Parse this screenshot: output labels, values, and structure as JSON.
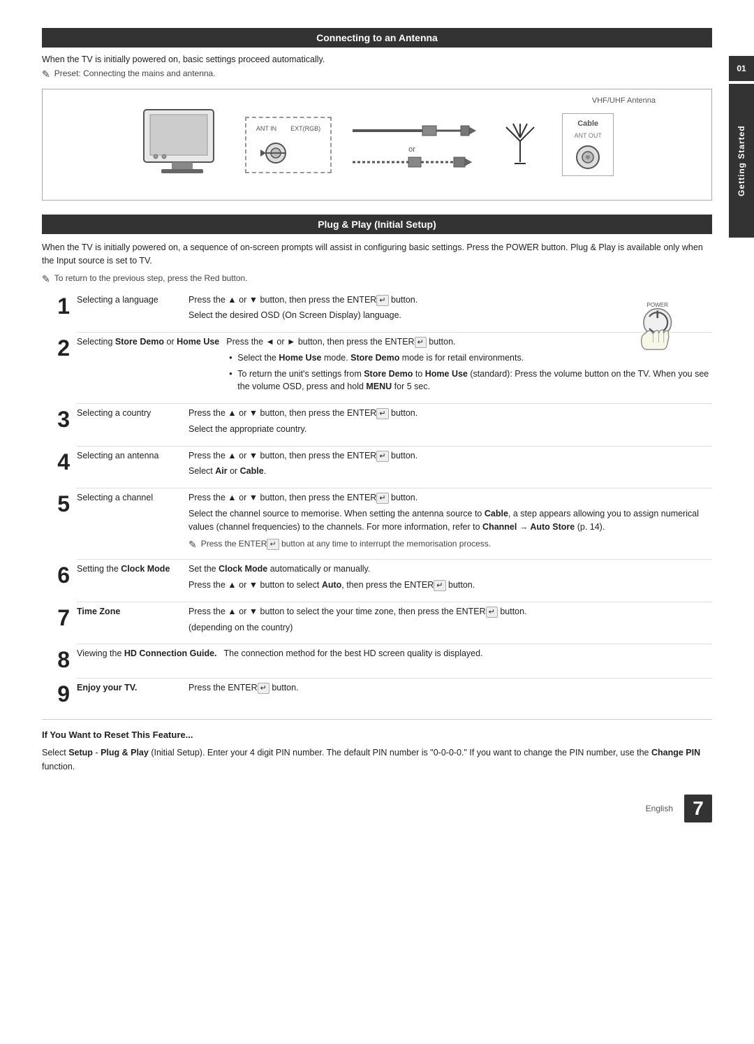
{
  "sidebar": {
    "number": "01",
    "label": "Getting Started"
  },
  "section1": {
    "header": "Connecting to an Antenna",
    "intro": "When the TV is initially powered on, basic settings proceed automatically.",
    "note": "Preset: Connecting the mains and antenna.",
    "diagram": {
      "vhf_label": "VHF/UHF Antenna",
      "cable_label": "Cable",
      "ant_in_label": "ANT IN",
      "ext_label": "EXT(RGB)",
      "ant_out_label": "ANT OUT",
      "or_text": "or"
    }
  },
  "section2": {
    "header": "Plug & Play (Initial Setup)",
    "intro": "When the TV is initially powered on, a sequence of on-screen prompts will assist in configuring basic settings. Press the POWER button. Plug & Play is available only when the Input source is set to TV.",
    "note": "To return to the previous step, press the Red button.",
    "steps": [
      {
        "number": "1",
        "label": "Selecting a language",
        "content_lines": [
          "Press the ▲ or ▼ button, then press the ENTER↵ button.",
          "Select the desired OSD (On Screen Display) language."
        ]
      },
      {
        "number": "2",
        "label_plain": "Selecting ",
        "label_bold": "Store Demo",
        "label_plain2": " or ",
        "label_bold2": "Home Use",
        "content_lines": [
          "Press the ◄ or ► button, then press the ENTER↵ button."
        ],
        "bullet_lines": [
          "Select the Home Use mode. Store Demo mode is for retail environments.",
          "To return the unit's settings from Store Demo to Home Use (standard): Press the volume button on the TV. When you see the volume OSD, press and hold MENU for 5 sec."
        ]
      },
      {
        "number": "3",
        "label": "Selecting a country",
        "content_lines": [
          "Press the ▲ or ▼ button, then press the ENTER↵ button.",
          "Select the appropriate country."
        ]
      },
      {
        "number": "4",
        "label": "Selecting an antenna",
        "content_lines": [
          "Press the ▲ or ▼ button, then press the ENTER↵ button.",
          "Select Air or Cable."
        ]
      },
      {
        "number": "5",
        "label": "Selecting a channel",
        "content_lines": [
          "Press the ▲ or ▼ button, then press the ENTER↵ button.",
          "Select the channel source to memorise. When setting the antenna source to Cable, a step appears allowing you to assign numerical values (channel frequencies) to the channels. For more information, refer to Channel → Auto Store (p. 14)."
        ],
        "note_line": "Press the ENTER↵ button at any time to interrupt the memorisation process."
      },
      {
        "number": "6",
        "label_plain": "Setting the ",
        "label_bold": "Clock Mode",
        "content_lines": [
          "Set the Clock Mode automatically or manually.",
          "Press the ▲ or ▼ button to select Auto, then press the ENTER↵ button."
        ]
      },
      {
        "number": "7",
        "label_bold": "Time Zone",
        "content_lines": [
          "Press the ▲ or ▼ button to select the your time zone, then press the ENTER↵ button.",
          "(depending on the country)"
        ]
      },
      {
        "number": "8",
        "label_plain": "Viewing the ",
        "label_bold": "HD Connection Guide.",
        "content_lines": [
          "The connection method for the best HD screen quality is displayed."
        ]
      },
      {
        "number": "9",
        "label_bold": "Enjoy your TV.",
        "content_lines": [
          "Press the ENTER↵ button."
        ]
      }
    ],
    "power_label": "POWER"
  },
  "reset_section": {
    "header": "If You Want to Reset This Feature...",
    "text": "Select Setup - Plug & Play (Initial Setup). Enter your 4 digit PIN number. The default PIN number is \"0-0-0-0.\" If you want to change the PIN number, use the Change PIN function."
  },
  "footer": {
    "lang": "English",
    "page": "7"
  }
}
